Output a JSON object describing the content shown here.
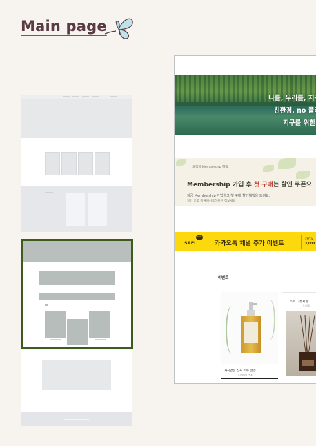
{
  "page": {
    "title": "Main page",
    "title_color": "#5a3a44",
    "selected_border_color": "#3d5a1f"
  },
  "preview": {
    "hero": {
      "line1": "나를, 우리를, 지구를",
      "line2": "친환경, no 플라스",
      "line3": "지구를 위한 5"
    },
    "membership": {
      "small": "오직힐 Membership 혜택",
      "headline_prefix": "Membership 가입 후 ",
      "headline_highlight": "첫 구매",
      "headline_suffix": "는 할인 쿠폰으",
      "desc1": "지금 Membership 가입하고 첫 구매 할인혜택을 드려요.",
      "desc2": "할인 받고 광류페쉬도하로된 적보세요"
    },
    "kakao": {
      "bubble": "talk",
      "brand": "SAFI",
      "title": "카카오톡 채널 추가 이벤트",
      "right1": "카카오",
      "right2": "3,000"
    },
    "event_label": "이벤트",
    "product1": {
      "name": "자극없는 샴푸 비누 알맹",
      "price": "5,000원  →  4"
    },
    "product2": {
      "title": "스트 디퓨저 향",
      "sub": "9,000"
    }
  }
}
